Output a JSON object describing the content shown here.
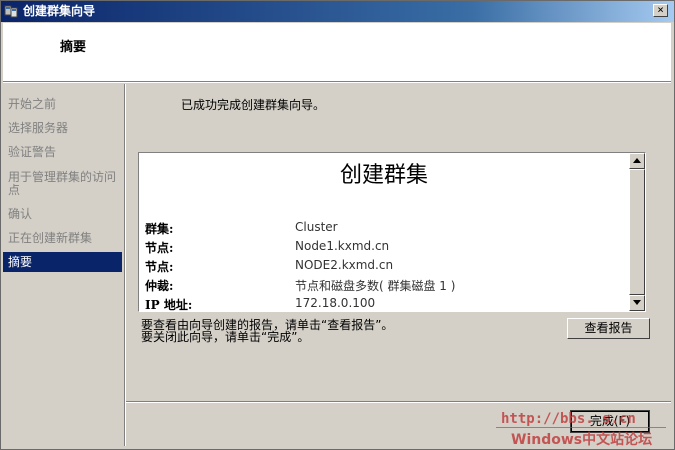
{
  "window": {
    "title": "创建群集向导",
    "close_glyph": "×"
  },
  "header": {
    "title": "摘要"
  },
  "nav": {
    "items": [
      {
        "label": "开始之前",
        "active": false
      },
      {
        "label": "选择服务器",
        "active": false
      },
      {
        "label": "验证警告",
        "active": false
      },
      {
        "label": "用于管理群集的访问点",
        "active": false
      },
      {
        "label": "确认",
        "active": false
      },
      {
        "label": "正在创建新群集",
        "active": false
      },
      {
        "label": "摘要",
        "active": true
      }
    ]
  },
  "main": {
    "success_message": "已成功完成创建群集向导。",
    "report": {
      "title": "创建群集",
      "rows": [
        {
          "label": "群集:",
          "value": "Cluster"
        },
        {
          "label": "节点:",
          "value": "Node1.kxmd.cn"
        },
        {
          "label": "节点:",
          "value": "NODE2.kxmd.cn"
        },
        {
          "label": "仲裁:",
          "value": "节点和磁盘多数( 群集磁盘 1 )"
        },
        {
          "label": "IP 地址:",
          "value": "172.18.0.100"
        }
      ]
    },
    "hint_line1": "要查看由向导创建的报告，请单击“查看报告”。",
    "hint_line2": "要关闭此向导，请单击“完成”。",
    "view_report_button": "查看报告",
    "finish_button": "完成(F)"
  },
  "watermark": {
    "line1": "http://bbs.       s.cn",
    "line2": "Windows中文站论坛"
  }
}
